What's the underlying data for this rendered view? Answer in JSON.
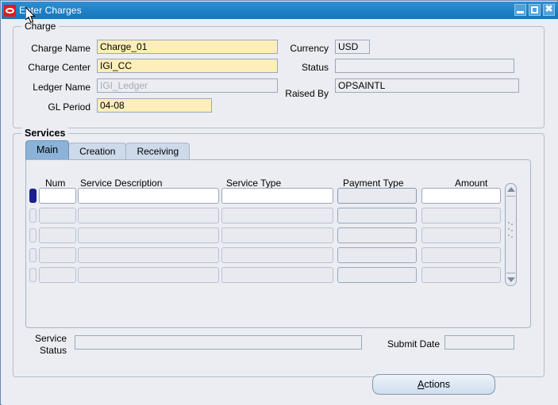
{
  "window": {
    "title": "Enter Charges",
    "logo_icon": "oracle-logo",
    "buttons": {
      "minimize": "minimize-icon",
      "maximize": "maximize-icon",
      "close": "✖"
    }
  },
  "charge": {
    "group_title": "Charge",
    "fields": {
      "charge_name": {
        "label": "Charge Name",
        "value": "Charge_01",
        "state": "required"
      },
      "charge_center": {
        "label": "Charge Center",
        "value": "IGI_CC",
        "state": "required"
      },
      "ledger_name": {
        "label": "Ledger Name",
        "value": "IGI_Ledger",
        "state": "disabled"
      },
      "gl_period": {
        "label": "GL Period",
        "value": "04-08",
        "state": "required"
      },
      "currency": {
        "label": "Currency",
        "value": "USD",
        "state": "readonly"
      },
      "status": {
        "label": "Status",
        "value": "",
        "state": "readonly"
      },
      "raised_by": {
        "label": "Raised By",
        "value": "OPSAINTL",
        "state": "readonly"
      }
    }
  },
  "services": {
    "group_title": "Services",
    "tabs": [
      {
        "label": "Main",
        "active": true
      },
      {
        "label": "Creation",
        "active": false
      },
      {
        "label": "Receiving",
        "active": false
      }
    ],
    "grid": {
      "columns": [
        "Num",
        "Service Description",
        "Service Type",
        "Payment Type",
        "Amount"
      ],
      "rows": [
        {
          "num": "",
          "description": "",
          "service_type": "",
          "payment_type": "",
          "amount": "",
          "selected": true
        },
        {
          "num": "",
          "description": "",
          "service_type": "",
          "payment_type": "",
          "amount": "",
          "selected": false
        },
        {
          "num": "",
          "description": "",
          "service_type": "",
          "payment_type": "",
          "amount": "",
          "selected": false
        },
        {
          "num": "",
          "description": "",
          "service_type": "",
          "payment_type": "",
          "amount": "",
          "selected": false
        },
        {
          "num": "",
          "description": "",
          "service_type": "",
          "payment_type": "",
          "amount": "",
          "selected": false
        }
      ],
      "scrollbar": "vertical-scrollbar"
    },
    "footer": {
      "service_status": {
        "label_line1": "Service",
        "label_line2": "Status",
        "value": ""
      },
      "submit_date": {
        "label": "Submit Date",
        "value": ""
      }
    }
  },
  "actions_button": {
    "mnemonic": "A",
    "rest": "ctions"
  },
  "colors": {
    "titlebar": "#1f7fc4",
    "window_background": "#ebedf2",
    "required_field": "#fdeeba",
    "selected_row_marker": "#1b1f8f",
    "active_tab": "#8bb2d8",
    "inactive_tab": "#ccdaea"
  }
}
